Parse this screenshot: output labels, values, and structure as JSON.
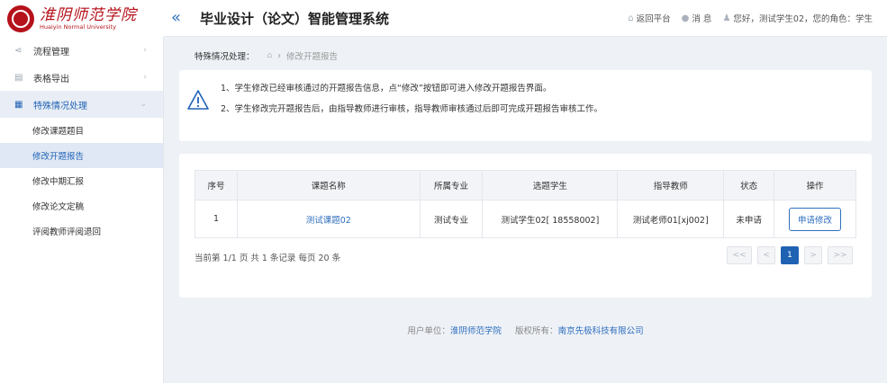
{
  "header": {
    "logo_cn": "淮阴师范学院",
    "logo_en": "Huaiyin Normal University",
    "collapse_icon": "double-chevron-left-icon",
    "title": "毕业设计（论文）智能管理系统",
    "back_label": "返回平台",
    "msg_label": "消 息",
    "greeting": "您好，测试学生02，您的角色：学生"
  },
  "sidebar": {
    "items": [
      {
        "label": "流程管理",
        "icon": "share-icon"
      },
      {
        "label": "表格导出",
        "icon": "table-export-icon"
      },
      {
        "label": "特殊情况处理",
        "icon": "document-edit-icon"
      }
    ],
    "subitems": [
      {
        "label": "修改课题题目"
      },
      {
        "label": "修改开题报告"
      },
      {
        "label": "修改中期汇报"
      },
      {
        "label": "修改论文定稿"
      },
      {
        "label": "评阅教师评阅退回"
      }
    ]
  },
  "breadcrumb": {
    "section": "特殊情况处理：",
    "page": "修改开题报告"
  },
  "notice": {
    "lines": [
      "1、学生修改已经审核通过的开题报告信息，点“修改”按钮即可进入修改开题报告界面。",
      "2、学生修改完开题报告后，由指导教师进行审核，指导教师审核通过后即可完成开题报告审核工作。"
    ]
  },
  "table": {
    "headers": [
      "序号",
      "课题名称",
      "所属专业",
      "选题学生",
      "指导教师",
      "状态",
      "操作"
    ],
    "rows": [
      {
        "no": "1",
        "topic": "测试课题02",
        "major": "测试专业",
        "student": "测试学生02[ 18558002]",
        "teacher": "测试老师01[xj002]",
        "status": "未申请",
        "action": "申请修改"
      }
    ]
  },
  "pagination": {
    "info": "当前第 1/1 页 共 1 条记录 每页 20 条",
    "first": "<<",
    "prev": "<",
    "current": "1",
    "next": ">",
    "last": ">>"
  },
  "footer": {
    "unit_label": "用户单位：",
    "unit": "淮阴师范学院",
    "copyright_label": "版权所有：",
    "company": "南京先极科技有限公司"
  },
  "colors": {
    "accent": "#1f62b4",
    "brand_red": "#b5121b"
  }
}
